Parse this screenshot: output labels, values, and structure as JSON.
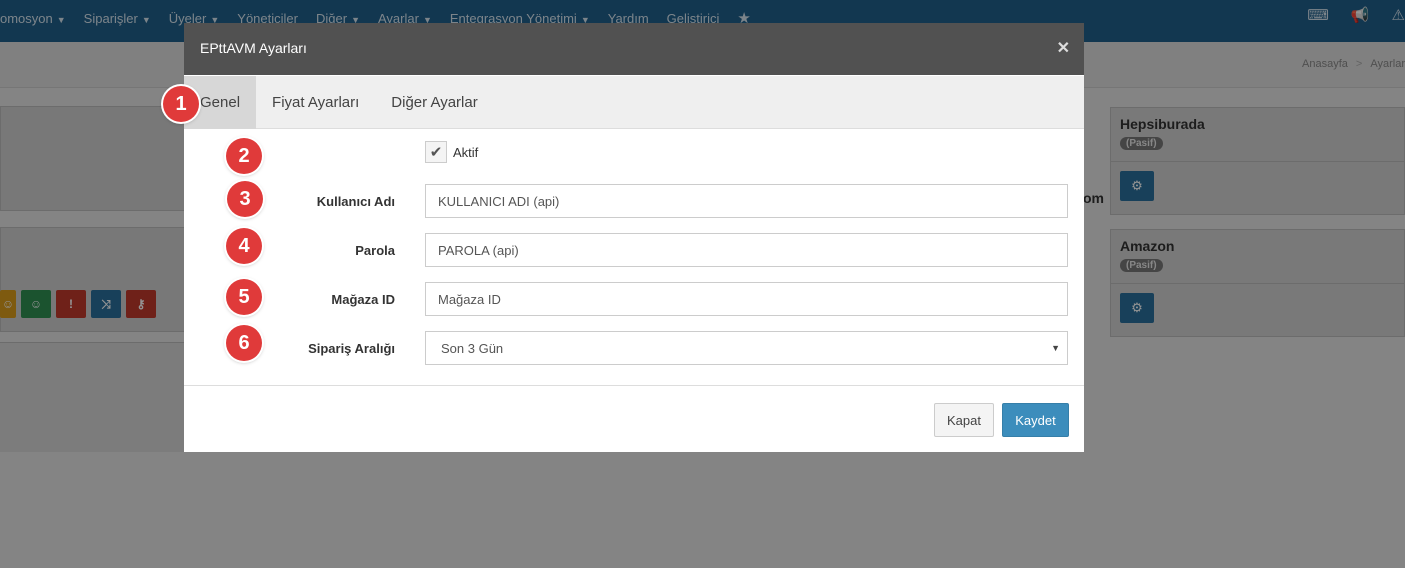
{
  "nav": {
    "items": [
      {
        "label": "omosyon"
      },
      {
        "label": "Siparişler"
      },
      {
        "label": "Üyeler"
      },
      {
        "label": "Yöneticiler"
      },
      {
        "label": "Diğer"
      },
      {
        "label": "Ayarlar"
      },
      {
        "label": "Entegrasyon Yönetimi"
      },
      {
        "label": "Yardım"
      },
      {
        "label": "Geliştirici"
      }
    ]
  },
  "breadcrumb": {
    "home": "Anasayfa",
    "current": "Ayarlar"
  },
  "cards": [
    {
      "title": "Hepsiburada",
      "status": "(Pasif)"
    },
    {
      "title": "Amazon",
      "status": "(Pasif)"
    }
  ],
  "background_fragment": "om",
  "modal": {
    "title": "EPttAVM Ayarları",
    "tabs": [
      {
        "label": "Genel",
        "active": true
      },
      {
        "label": "Fiyat Ayarları",
        "active": false
      },
      {
        "label": "Diğer Ayarlar",
        "active": false
      }
    ],
    "active_checkbox": {
      "label": "Aktif",
      "checked": true
    },
    "fields": {
      "username": {
        "label": "Kullanıcı Adı",
        "placeholder": "KULLANICI ADI (api)",
        "value": ""
      },
      "password": {
        "label": "Parola",
        "placeholder": "PAROLA (api)",
        "value": ""
      },
      "store_id": {
        "label": "Mağaza ID",
        "placeholder": "Mağaza ID",
        "value": ""
      },
      "order_range": {
        "label": "Sipariş Aralığı",
        "selected": "Son 3 Gün"
      }
    },
    "buttons": {
      "close": "Kapat",
      "save": "Kaydet"
    }
  },
  "markers": [
    "1",
    "2",
    "3",
    "4",
    "5",
    "6"
  ],
  "colors": {
    "primary": "#3c8dbc",
    "navbar": "#1f5f8b",
    "marker": "#e03a3a",
    "modal_header": "#515151"
  }
}
